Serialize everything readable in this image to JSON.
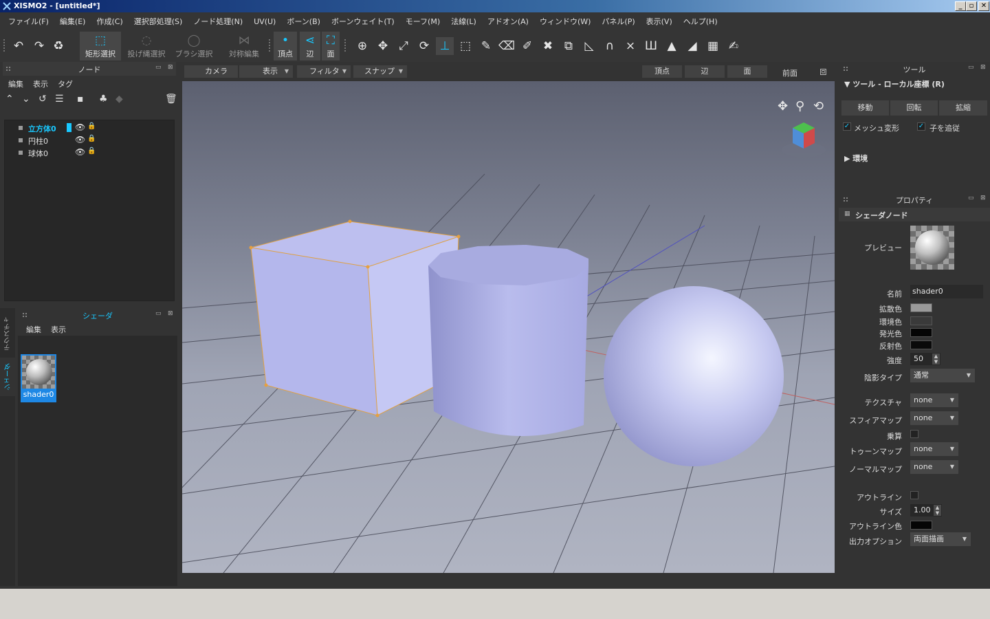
{
  "window": {
    "title": "XISMO2 - [untitled*]",
    "minimize": "_",
    "maximize": "▫",
    "close": "✕"
  },
  "menu": [
    "ファイル(F)",
    "編集(E)",
    "作成(C)",
    "選択部処理(S)",
    "ノード処理(N)",
    "UV(U)",
    "ボーン(B)",
    "ボーンウェイト(T)",
    "モーフ(M)",
    "法線(L)",
    "アドオン(A)",
    "ウィンドウ(W)",
    "パネル(P)",
    "表示(V)",
    "ヘルプ(H)"
  ],
  "toolbar": {
    "rect_select": "矩形選択",
    "lasso_select": "投げ縄選択",
    "brush_select": "ブラシ選択",
    "symmetric_edit": "対称編集",
    "vertex": "頂点",
    "edge": "辺",
    "face": "面"
  },
  "node_panel": {
    "title": "ノード",
    "menus": [
      "編集",
      "表示",
      "タグ"
    ],
    "nodes": [
      {
        "name": "立方体0",
        "selected": true
      },
      {
        "name": "円柱0",
        "selected": false
      },
      {
        "name": "球体0",
        "selected": false
      }
    ]
  },
  "shader_panel": {
    "title": "シェーダ",
    "menus": [
      "編集",
      "表示"
    ],
    "side_tabs": [
      "テクスチャ",
      "シェーダ"
    ],
    "items": [
      {
        "name": "shader0"
      }
    ]
  },
  "viewport": {
    "buttons": {
      "camera": "カメラ",
      "view": "表示",
      "filter": "フィルタ",
      "snap": "スナップ"
    },
    "modes": {
      "vertex": "頂点",
      "edge": "辺",
      "face": "面"
    },
    "view_name": "前面"
  },
  "tool_panel": {
    "title": "ツール",
    "section": "ツール - ローカル座標 (R)",
    "buttons": [
      "移動",
      "回転",
      "拡縮"
    ],
    "mesh_deform": "メッシュ変形",
    "follow_children": "子を追従",
    "environment": "環境"
  },
  "properties": {
    "title": "プロパティ",
    "section": "シェーダノード",
    "preview_label": "プレビュー",
    "name_label": "名前",
    "name_value": "shader0",
    "diffuse_label": "拡散色",
    "ambient_label": "環境色",
    "emissive_label": "発光色",
    "specular_label": "反射色",
    "strength_label": "強度",
    "strength_value": "50",
    "shading_label": "陰影タイプ",
    "shading_value": "通常",
    "texture_label": "テクスチャ",
    "texture_value": "none",
    "sphere_label": "スフィアマップ",
    "sphere_value": "none",
    "multiply_label": "乗算",
    "toon_label": "トゥーンマップ",
    "toon_value": "none",
    "normal_label": "ノーマルマップ",
    "normal_value": "none",
    "outline_label": "アウトライン",
    "size_label": "サイズ",
    "size_value": "1.00",
    "outline_color_label": "アウトライン色",
    "output_label": "出力オプション",
    "output_value": "両面描画",
    "colors": {
      "diffuse": "#9a9a9a",
      "ambient": "#3a3a3a",
      "emissive": "#050505",
      "specular": "#0a0a0a",
      "outline": "#050505"
    }
  }
}
